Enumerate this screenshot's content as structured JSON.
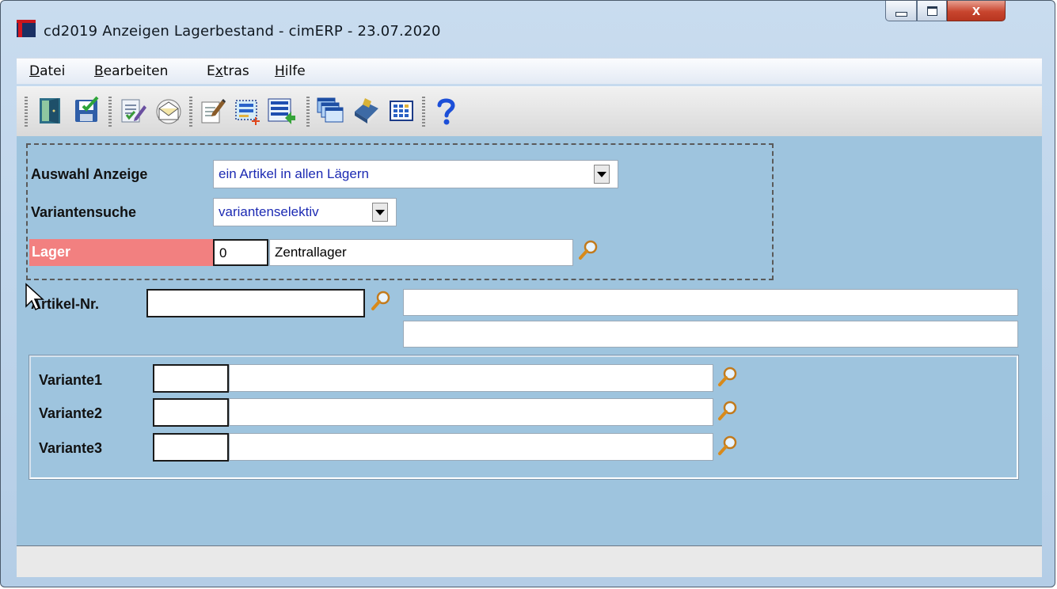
{
  "window": {
    "title": "cd2019 Anzeigen Lagerbestand - cimERP - 23.07.2020",
    "close_glyph": "x"
  },
  "menu": {
    "items": [
      {
        "label": "Datei",
        "underline": "D",
        "rest": "atei"
      },
      {
        "label": "Bearbeiten",
        "underline": "B",
        "rest": "earbeiten"
      },
      {
        "label": "Extras",
        "underline_pre": "E",
        "underline": "x",
        "rest": "tras"
      },
      {
        "label": "Hilfe",
        "underline": "H",
        "rest": "ilfe"
      }
    ]
  },
  "toolbar": {
    "icons": [
      "exit-door-icon",
      "save-icon",
      "edit-document-icon",
      "mail-icon",
      "edit-note-icon",
      "new-selection-icon",
      "list-import-icon",
      "windows-cascade-icon",
      "book-icon",
      "calculator-icon",
      "help-icon"
    ]
  },
  "form": {
    "auswahl_label": "Auswahl Anzeige",
    "auswahl_value": "ein Artikel in allen Lägern",
    "variantensuche_label": "Variantensuche",
    "variantensuche_value": "variantenselektiv",
    "lager_label": "Lager",
    "lager_code": "0",
    "lager_name": "Zentrallager",
    "artikel_label": "Artikel-Nr.",
    "artikel_value": "",
    "artikel_desc1": "",
    "artikel_desc2": "",
    "variants": [
      {
        "label": "Variante1",
        "code": "",
        "desc": ""
      },
      {
        "label": "Variante2",
        "code": "",
        "desc": ""
      },
      {
        "label": "Variante3",
        "code": "",
        "desc": ""
      }
    ]
  },
  "status": {
    "text": ""
  }
}
